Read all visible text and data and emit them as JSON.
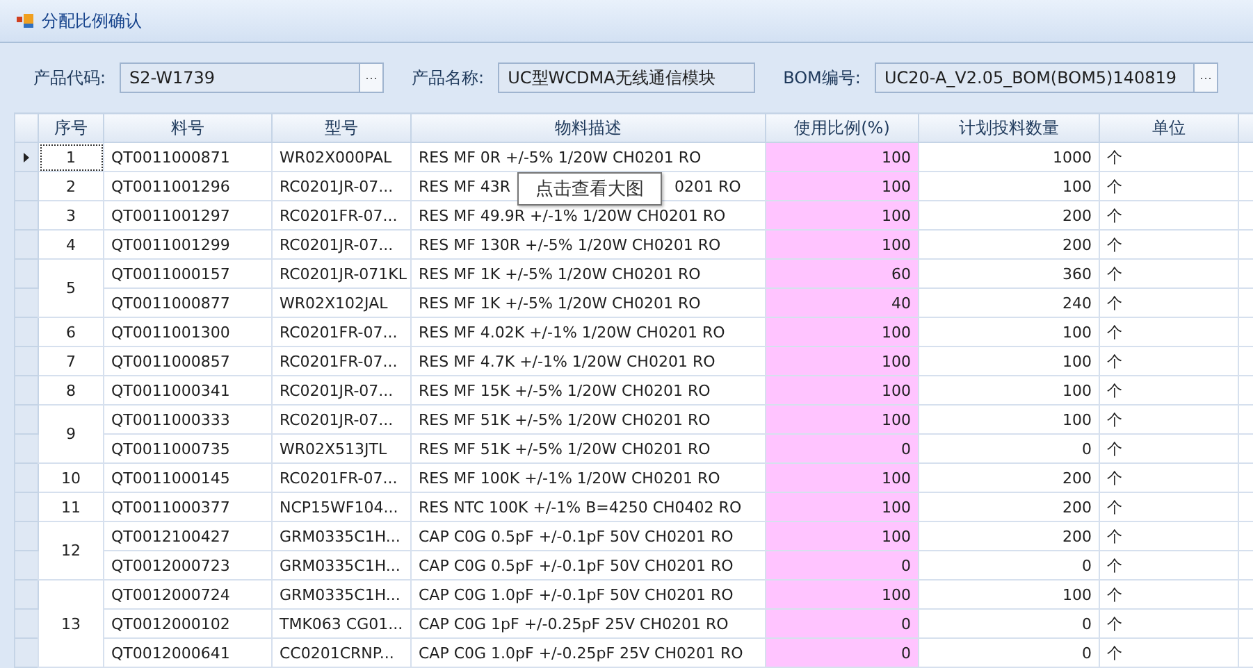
{
  "window": {
    "title": "分配比例确认"
  },
  "fields": [
    {
      "label": "产品代码:",
      "value": "S2-W1739",
      "browse": "···"
    },
    {
      "label": "产品名称:",
      "value": "UC型WCDMA无线通信模块"
    },
    {
      "label": "BOM编号:",
      "value": "UC20-A_V2.05_BOM(BOM5)140819",
      "browse": "···"
    }
  ],
  "table": {
    "columns": [
      "序号",
      "料号",
      "型号",
      "物料描述",
      "使用比例(%)",
      "计划投料数量",
      "单位"
    ],
    "groups": [
      {
        "seq": "1",
        "items": [
          {
            "part": "QT0011000871",
            "model": "WR02X000PAL",
            "description": "RES MF 0R +/-5% 1/20W CH0201 RO",
            "ratio": "100",
            "qty": "1000",
            "unit": "个",
            "current": true
          }
        ]
      },
      {
        "seq": "2",
        "items": [
          {
            "part": "QT0011001296",
            "model": "RC0201JR-07...",
            "description": "RES MF 43R",
            "description_after_tooltip": "0201 RO",
            "ratio": "100",
            "qty": "100",
            "unit": "个",
            "current": false
          }
        ]
      },
      {
        "seq": "3",
        "items": [
          {
            "part": "QT0011001297",
            "model": "RC0201FR-07...",
            "description": "RES MF 49.9R +/-1% 1/20W CH0201 RO",
            "ratio": "100",
            "qty": "200",
            "unit": "个",
            "current": false
          }
        ]
      },
      {
        "seq": "4",
        "items": [
          {
            "part": "QT0011001299",
            "model": "RC0201JR-07...",
            "description": "RES MF 130R +/-5% 1/20W CH0201 RO",
            "ratio": "100",
            "qty": "200",
            "unit": "个",
            "current": false
          }
        ]
      },
      {
        "seq": "5",
        "items": [
          {
            "part": "QT0011000157",
            "model": "RC0201JR-071KL",
            "description": "RES MF 1K +/-5% 1/20W CH0201 RO",
            "ratio": "60",
            "qty": "360",
            "unit": "个",
            "current": false
          },
          {
            "part": "QT0011000877",
            "model": "WR02X102JAL",
            "description": "RES MF 1K +/-5% 1/20W CH0201 RO",
            "ratio": "40",
            "qty": "240",
            "unit": "个",
            "current": false
          }
        ]
      },
      {
        "seq": "6",
        "items": [
          {
            "part": "QT0011001300",
            "model": "RC0201FR-07...",
            "description": "RES MF 4.02K +/-1% 1/20W CH0201 RO",
            "ratio": "100",
            "qty": "100",
            "unit": "个",
            "current": false
          }
        ]
      },
      {
        "seq": "7",
        "items": [
          {
            "part": "QT0011000857",
            "model": "RC0201FR-07...",
            "description": "RES MF 4.7K +/-1% 1/20W CH0201 RO",
            "ratio": "100",
            "qty": "100",
            "unit": "个",
            "current": false
          }
        ]
      },
      {
        "seq": "8",
        "items": [
          {
            "part": "QT0011000341",
            "model": "RC0201JR-07...",
            "description": "RES MF 15K +/-5% 1/20W CH0201 RO",
            "ratio": "100",
            "qty": "100",
            "unit": "个",
            "current": false
          }
        ]
      },
      {
        "seq": "9",
        "items": [
          {
            "part": "QT0011000333",
            "model": "RC0201JR-07...",
            "description": "RES MF 51K +/-5% 1/20W CH0201 RO",
            "ratio": "100",
            "qty": "100",
            "unit": "个",
            "current": false
          },
          {
            "part": "QT0011000735",
            "model": "WR02X513JTL",
            "description": "RES MF 51K +/-5% 1/20W CH0201 RO",
            "ratio": "0",
            "qty": "0",
            "unit": "个",
            "current": false
          }
        ]
      },
      {
        "seq": "10",
        "items": [
          {
            "part": "QT0011000145",
            "model": "RC0201FR-07...",
            "description": "RES MF 100K +/-1% 1/20W CH0201 RO",
            "ratio": "100",
            "qty": "200",
            "unit": "个",
            "current": false
          }
        ]
      },
      {
        "seq": "11",
        "items": [
          {
            "part": "QT0011000377",
            "model": "NCP15WF104...",
            "description": "RES NTC 100K +/-1% B=4250 CH0402 RO",
            "ratio": "100",
            "qty": "200",
            "unit": "个",
            "current": false
          }
        ]
      },
      {
        "seq": "12",
        "items": [
          {
            "part": "QT0012100427",
            "model": "GRM0335C1H...",
            "description": "CAP C0G 0.5pF +/-0.1pF 50V CH0201 RO",
            "ratio": "100",
            "qty": "200",
            "unit": "个",
            "current": false
          },
          {
            "part": "QT0012000723",
            "model": "GRM0335C1H...",
            "description": "CAP C0G 0.5pF +/-0.1pF 50V CH0201 RO",
            "ratio": "0",
            "qty": "0",
            "unit": "个",
            "current": false
          }
        ]
      },
      {
        "seq": "13",
        "items": [
          {
            "part": "QT0012000724",
            "model": "GRM0335C1H...",
            "description": "CAP C0G 1.0pF +/-0.1pF 50V CH0201 RO",
            "ratio": "100",
            "qty": "100",
            "unit": "个",
            "current": false
          },
          {
            "part": "QT0012000102",
            "model": "TMK063 CG01...",
            "description": "CAP C0G 1pF +/-0.25pF 25V CH0201 RO",
            "ratio": "0",
            "qty": "0",
            "unit": "个",
            "current": false
          },
          {
            "part": "QT0012000641",
            "model": "CC0201CRNP...",
            "description": "CAP C0G 1.0pF +/-0.25pF 25V CH0201 RO",
            "ratio": "0",
            "qty": "0",
            "unit": "个",
            "current": false
          }
        ]
      }
    ]
  },
  "tooltip": "点击查看大图"
}
